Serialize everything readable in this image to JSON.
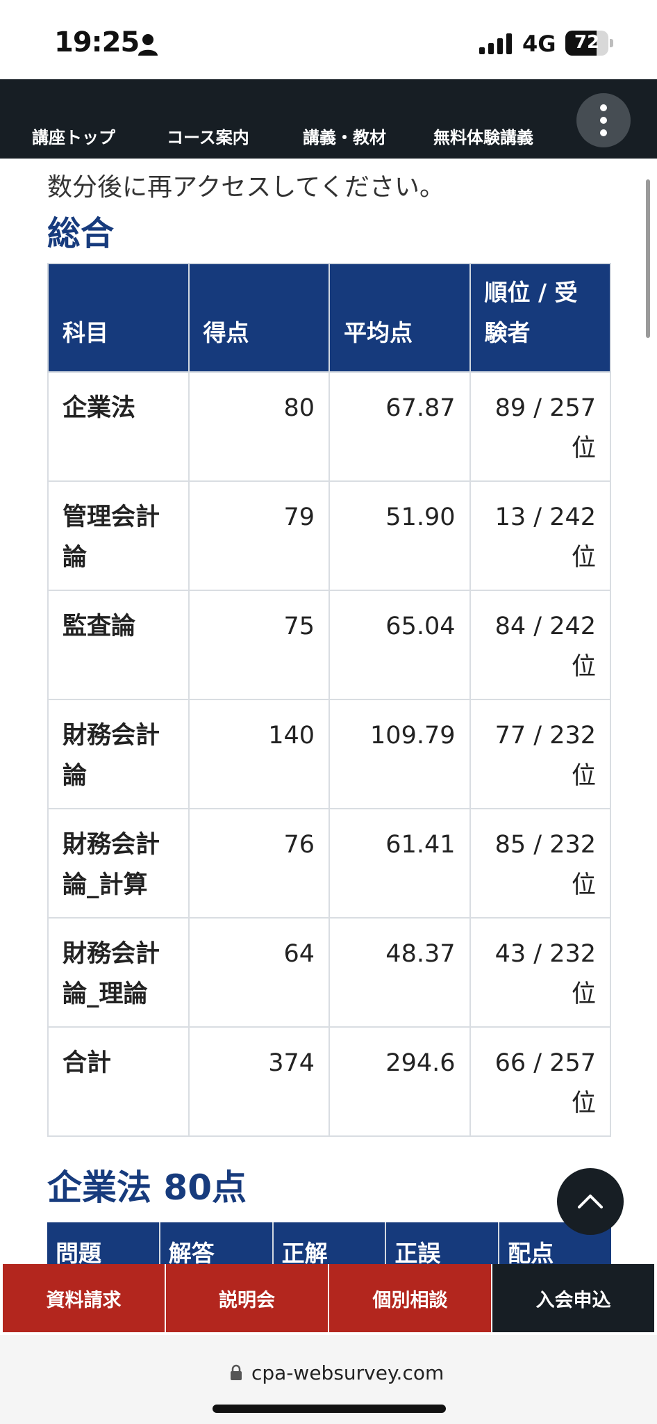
{
  "status_bar": {
    "time": "19:25",
    "network": "4G",
    "battery_level": "72",
    "battery_fraction": 0.72
  },
  "nav": {
    "items": [
      {
        "label": "講座トップ"
      },
      {
        "label": "コース案内"
      },
      {
        "label": "講義・教材"
      },
      {
        "label": "無料体験講義"
      }
    ],
    "more_icon": "more-vertical-icon"
  },
  "main": {
    "notice": "数分後に再アクセスしてください。",
    "section_title": "総合",
    "table": {
      "headers": [
        "科目",
        "得点",
        "平均点",
        "順位 / 受験者"
      ],
      "rows": [
        {
          "subject": "企業法",
          "score": "80",
          "average": "67.87",
          "rank": "89 / 257位"
        },
        {
          "subject": "管理会計論",
          "score": "79",
          "average": "51.90",
          "rank": "13 / 242位"
        },
        {
          "subject": "監査論",
          "score": "75",
          "average": "65.04",
          "rank": "84 / 242位"
        },
        {
          "subject": "財務会計論",
          "score": "140",
          "average": "109.79",
          "rank": "77 / 232位"
        },
        {
          "subject": "財務会計論_計算",
          "score": "76",
          "average": "61.41",
          "rank": "85 / 232位"
        },
        {
          "subject": "財務会計論_理論",
          "score": "64",
          "average": "48.37",
          "rank": "43 / 232位"
        },
        {
          "subject": "合計",
          "score": "374",
          "average": "294.6",
          "rank": "66 / 257位"
        }
      ]
    },
    "subsection_title": "企業法 80点",
    "detail_headers": [
      "問題",
      "解答",
      "正解",
      "正誤",
      "配点"
    ]
  },
  "bottom_bar": {
    "buttons": [
      {
        "label": "資料請求",
        "color": "#b3261e"
      },
      {
        "label": "説明会",
        "color": "#b3261e"
      },
      {
        "label": "個別相談",
        "color": "#b3261e"
      },
      {
        "label": "入会申込",
        "color": "#171e24"
      }
    ]
  },
  "browser": {
    "url": "cpa-websurvey.com"
  },
  "colors": {
    "brand_navy": "#163a7c",
    "nav_dark": "#171e24",
    "cta_red": "#b3261e"
  }
}
